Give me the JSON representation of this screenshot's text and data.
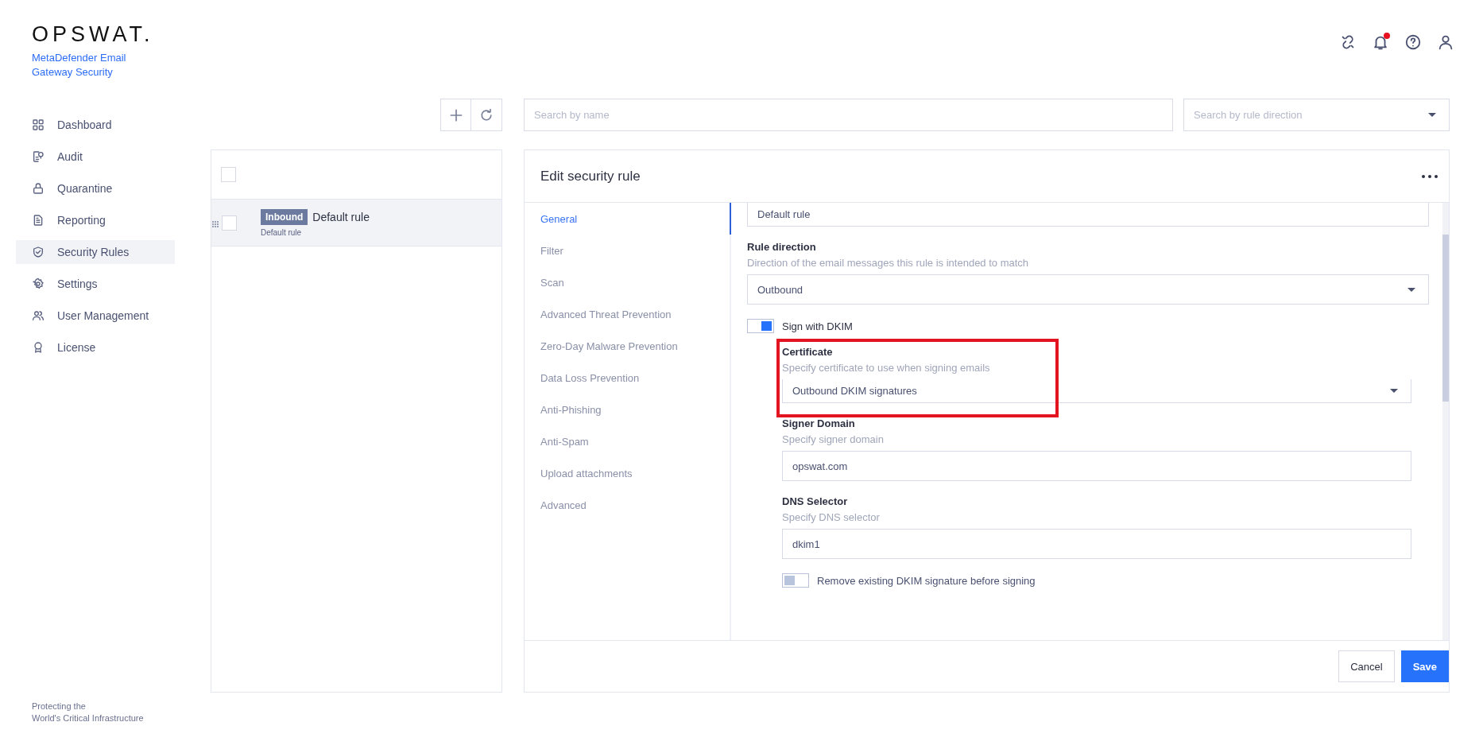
{
  "logo": {
    "wordmark": "OPSWAT.",
    "product": "MetaDefender Email Gateway Security"
  },
  "header": {
    "notifications_unread": true
  },
  "sidebar": {
    "items": [
      {
        "label": "Dashboard",
        "selected": false
      },
      {
        "label": "Audit",
        "selected": false
      },
      {
        "label": "Quarantine",
        "selected": false
      },
      {
        "label": "Reporting",
        "selected": false
      },
      {
        "label": "Security Rules",
        "selected": true
      },
      {
        "label": "Settings",
        "selected": false
      },
      {
        "label": "User Management",
        "selected": false
      },
      {
        "label": "License",
        "selected": false
      }
    ],
    "footer": "Protecting the\nWorld's Critical Infrastructure"
  },
  "toolbar": {
    "search": {
      "placeholder": "Search by name"
    },
    "direction_filter": {
      "placeholder": "Search by rule direction"
    }
  },
  "rule_list": {
    "select_all": {
      "checked": false
    },
    "rows": [
      {
        "badge": "Inbound",
        "name": "Default rule",
        "description": "Default rule",
        "selected": true,
        "checked": false
      }
    ]
  },
  "editor": {
    "title": "Edit security rule",
    "sections": [
      {
        "label": "General",
        "selected": true
      },
      {
        "label": "Filter",
        "selected": false
      },
      {
        "label": "Scan",
        "selected": false
      },
      {
        "label": "Advanced Threat Prevention",
        "selected": false
      },
      {
        "label": "Zero-Day Malware Prevention",
        "selected": false
      },
      {
        "label": "Data Loss Prevention",
        "selected": false
      },
      {
        "label": "Anti-Phishing",
        "selected": false
      },
      {
        "label": "Anti-Spam",
        "selected": false
      },
      {
        "label": "Upload attachments",
        "selected": false
      },
      {
        "label": "Advanced",
        "selected": false
      }
    ],
    "fields": [
      {
        "kind": "text",
        "value": "Default rule"
      },
      {
        "kind": "select",
        "label": "Rule direction",
        "description": "Direction of the email messages this rule is intended to match",
        "value": "Outbound"
      },
      {
        "kind": "toggle",
        "label": "Sign with DKIM",
        "on": true,
        "children": [
          {
            "kind": "select",
            "label": "Certificate",
            "description": "Specify certificate to use when signing emails",
            "value": "Outbound DKIM signatures",
            "highlighted": true
          },
          {
            "kind": "text",
            "label": "Signer Domain",
            "description": "Specify signer domain",
            "value": "opswat.com"
          },
          {
            "kind": "text",
            "label": "DNS Selector",
            "description": "Specify DNS selector",
            "value": "dkim1"
          },
          {
            "kind": "toggle",
            "label": "Remove existing DKIM signature before signing",
            "on": false
          }
        ]
      }
    ],
    "buttons": [
      {
        "label": "Cancel",
        "kind": "secondary"
      },
      {
        "label": "Save",
        "kind": "primary"
      }
    ]
  }
}
